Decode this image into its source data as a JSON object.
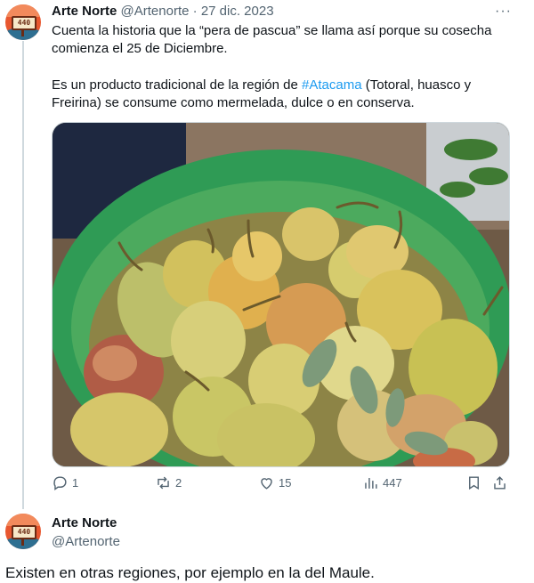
{
  "tweet": {
    "author_name": "Arte Norte",
    "author_handle": "@Artenorte",
    "separator": "·",
    "date": "27 dic. 2023",
    "more_label": "···",
    "avatar_text": "440",
    "line1": "Cuenta la historia que la “pera de pascua” se llama así porque su cosecha",
    "line2": "comienza el 25 de Diciembre.",
    "line3_pre": "Es un producto tradicional de la región de ",
    "line3_tag": "#Atacama",
    "line3_post": " (Totoral, huasco y",
    "line4": "Freirina) se consume como mermelada, dulce o en conserva.",
    "stats": {
      "replies": "1",
      "reposts": "2",
      "likes": "15",
      "views": "447"
    }
  },
  "reply": {
    "author_name": "Arte Norte",
    "author_handle": "@Artenorte",
    "avatar_text": "440",
    "text": "Existen en otras regiones, por ejemplo en la del Maule."
  }
}
